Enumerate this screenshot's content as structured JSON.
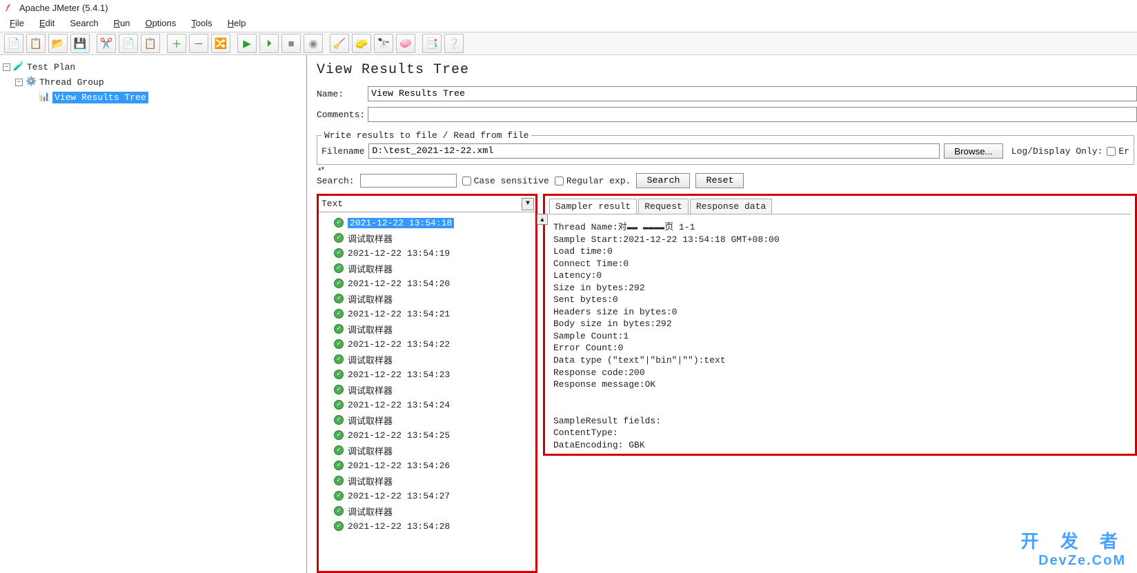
{
  "window": {
    "title": "Apache JMeter (5.4.1)"
  },
  "menu": {
    "file": "File",
    "edit": "Edit",
    "search": "Search",
    "run": "Run",
    "options": "Options",
    "tools": "Tools",
    "help": "Help"
  },
  "tree": {
    "test_plan": "Test Plan",
    "thread_group": "Thread Group",
    "view_results_tree": "View Results Tree"
  },
  "panel": {
    "heading": "View Results Tree",
    "name_label": "Name:",
    "name_value": "View Results Tree",
    "comments_label": "Comments:",
    "comments_value": ""
  },
  "fileio": {
    "legend": "Write results to file / Read from file",
    "filename_label": "Filename",
    "filename_value": "D:\\test_2021-12-22.xml",
    "browse": "Browse...",
    "log_display_only": "Log/Display Only:",
    "err_cb": "Er"
  },
  "search_row": {
    "label": "Search:",
    "case_sensitive": "Case sensitive",
    "regular_exp": "Regular exp.",
    "search_btn": "Search",
    "reset_btn": "Reset"
  },
  "renderer": {
    "selected": "Text"
  },
  "results": [
    {
      "label": "2021-12-22 13:54:18",
      "selected": true
    },
    {
      "label": "调试取样器"
    },
    {
      "label": "2021-12-22 13:54:19"
    },
    {
      "label": "调试取样器"
    },
    {
      "label": "2021-12-22 13:54:20"
    },
    {
      "label": "调试取样器"
    },
    {
      "label": "2021-12-22 13:54:21"
    },
    {
      "label": "调试取样器"
    },
    {
      "label": "2021-12-22 13:54:22"
    },
    {
      "label": "调试取样器"
    },
    {
      "label": "2021-12-22 13:54:23"
    },
    {
      "label": "调试取样器"
    },
    {
      "label": "2021-12-22 13:54:24"
    },
    {
      "label": "调试取样器"
    },
    {
      "label": "2021-12-22 13:54:25"
    },
    {
      "label": "调试取样器"
    },
    {
      "label": "2021-12-22 13:54:26"
    },
    {
      "label": "调试取样器"
    },
    {
      "label": "2021-12-22 13:54:27"
    },
    {
      "label": "调试取样器"
    },
    {
      "label": "2021-12-22 13:54:28"
    }
  ],
  "tabs": {
    "sampler_result": "Sampler result",
    "request": "Request",
    "response_data": "Response data"
  },
  "sampler": {
    "lines": [
      "Thread Name:对▬▬ ▬▬▬▬页 1-1",
      "Sample Start:2021-12-22 13:54:18 GMT+08:00",
      "Load time:0",
      "Connect Time:0",
      "Latency:0",
      "Size in bytes:292",
      "Sent bytes:0",
      "Headers size in bytes:0",
      "Body size in bytes:292",
      "Sample Count:1",
      "Error Count:0",
      "Data type (\"text\"|\"bin\"|\"\"):text",
      "Response code:200",
      "Response message:OK",
      "",
      "",
      "SampleResult fields:",
      "ContentType:",
      "DataEncoding: GBK"
    ]
  },
  "watermark": {
    "line1": "开 发 者",
    "line2": "DevZe.CoM"
  }
}
